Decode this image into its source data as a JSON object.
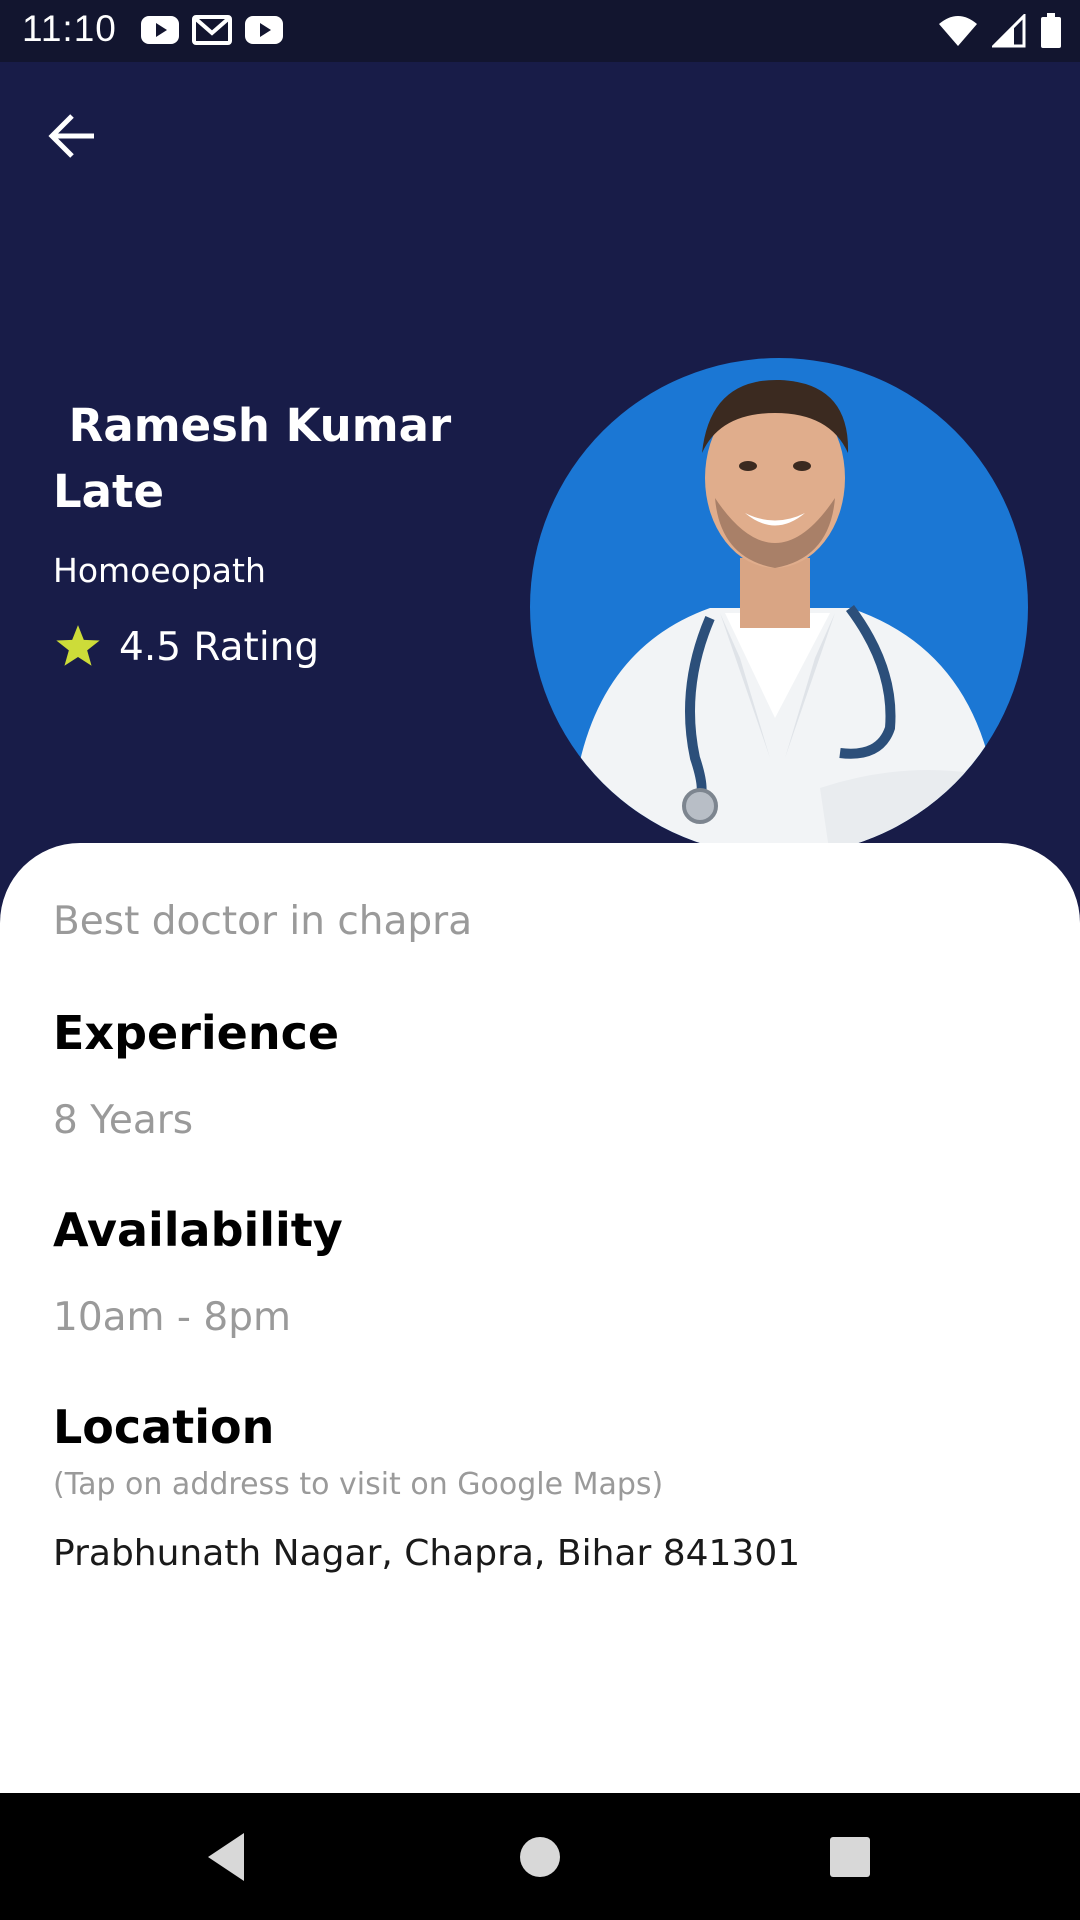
{
  "status_bar": {
    "time": "11:10",
    "left_icons": [
      "youtube-icon",
      "gmail-icon",
      "youtube-icon"
    ],
    "right_icons": [
      "wifi-icon",
      "cellular-signal-icon",
      "battery-icon"
    ]
  },
  "header": {
    "back_icon": "arrow-left-icon",
    "doctor_name": " Ramesh Kumar\nLate",
    "specialty": "Homoeopath",
    "rating_text": "4.5 Rating",
    "star_color": "#cddc39",
    "background_color": "#181c48",
    "avatar_bg_color": "#1b77d4"
  },
  "details": {
    "about": "Best doctor in chapra",
    "experience_title": "Experience",
    "experience_value": "8 Years",
    "availability_title": "Availability",
    "availability_value": "10am - 8pm",
    "location_title": "Location",
    "location_hint": "(Tap on address to visit on Google Maps)",
    "location_address": "Prabhunath Nagar, Chapra, Bihar 841301"
  },
  "nav_bar": {
    "buttons": [
      "back-triangle-icon",
      "home-circle-icon",
      "recents-square-icon"
    ]
  }
}
